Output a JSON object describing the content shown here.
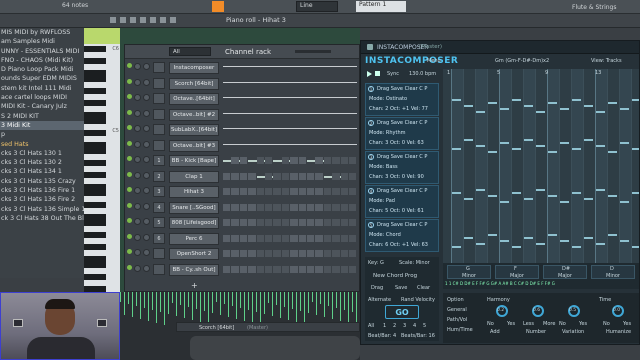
{
  "topbar": {
    "notes_label": "64 notes",
    "line_label": "Line",
    "pattern_label": "Pattern 1",
    "instrument": "Flute & Strings"
  },
  "pianoroll": {
    "title": "Piano roll - Hihat 3"
  },
  "browser": {
    "items": [
      {
        "label": "MIS MIDI by RWFLOSS",
        "state": "normal"
      },
      {
        "label": "am Samples Midi",
        "state": "normal"
      },
      {
        "label": "UNNY - ESSENTIALS MIDI",
        "state": "normal"
      },
      {
        "label": "FNO - CHAOS (Midi Kit)",
        "state": "normal"
      },
      {
        "label": "D Piano Loop Pack Midi",
        "state": "normal"
      },
      {
        "label": "ounds Super EDM MIDIS",
        "state": "normal"
      },
      {
        "label": "stem kit Intel 111 Midi",
        "state": "normal"
      },
      {
        "label": "ace cartel loops MIDI",
        "state": "normal"
      },
      {
        "label": "MIDI Kit - Canary Julz",
        "state": "normal"
      },
      {
        "label": "S 2 MIDI KIT",
        "state": "normal"
      },
      {
        "label": "3 Midi Kit",
        "state": "highlight"
      },
      {
        "label": "p",
        "state": "normal"
      },
      {
        "label": "sed Hats",
        "state": "folder"
      },
      {
        "label": "cks 3 Cl Hats 130 1",
        "state": "normal"
      },
      {
        "label": "cks 3 Cl Hats 130 2",
        "state": "normal"
      },
      {
        "label": "cks 3 Cl Hats 134 1",
        "state": "normal"
      },
      {
        "label": "cks 3 Cl Hats 135 Crazy",
        "state": "normal"
      },
      {
        "label": "cks 3 Cl Hats 136 Fire 1",
        "state": "normal"
      },
      {
        "label": "cks 3 Cl Hats 136 Fire 2",
        "state": "normal"
      },
      {
        "label": "cks 3 Cl Hats 136 Simple 1",
        "state": "normal"
      },
      {
        "label": "ck 3 Cl Hats 38 Out The Blue",
        "state": "normal"
      }
    ]
  },
  "piano_keys": {
    "c6": "C6",
    "c5": "C5"
  },
  "rack": {
    "filter": "All",
    "title": "Channel rack",
    "channels": [
      {
        "num": "",
        "name": "Instacomposer"
      },
      {
        "num": "",
        "name": "Scorch [64bit]"
      },
      {
        "num": "",
        "name": "Octave..[64bit]"
      },
      {
        "num": "",
        "name": "Octave..bit] #2"
      },
      {
        "num": "",
        "name": "SubLabX..[64bit]"
      },
      {
        "num": "",
        "name": "Octave..bit] #3"
      },
      {
        "num": "1",
        "name": "BB - Kick [Bape]"
      },
      {
        "num": "2",
        "name": "Clap 1"
      },
      {
        "num": "3",
        "name": "Hihat 3"
      },
      {
        "num": "4",
        "name": "Snare [..SGood]"
      },
      {
        "num": "5",
        "name": "808 [Lifeisgood]"
      },
      {
        "num": "6",
        "name": "Perc 6"
      },
      {
        "num": "",
        "name": "OpenShort 2"
      },
      {
        "num": "",
        "name": "BB - Cy..sh Out]"
      }
    ],
    "add_label": "+"
  },
  "bottom_track": {
    "label": "Scorch [64bit]",
    "sublabel": "(Master)"
  },
  "insta": {
    "title": "INSTACOMPOSER",
    "subtitle": "(Master)",
    "menu": "Menu",
    "bpm_label": "Sync",
    "bpm": "130.0 bpm",
    "progression": "Gm (Gm-F-D#-Dm)x2",
    "view": "View: Tracks",
    "pos": "Pos: Beats",
    "bars": [
      "1",
      "5",
      "9",
      "13"
    ],
    "cards": [
      {
        "n": "1",
        "actions": "Drag Save Clear C P",
        "mode": "Mode: Ostinato",
        "chan": "Chan: 2   Oct: +1   Vel: 77"
      },
      {
        "n": "2",
        "actions": "Drag Save Clear C P",
        "mode": "Mode: Rhythm",
        "chan": "Chan: 3   Oct: 0   Vel: 63"
      },
      {
        "n": "3",
        "actions": "Drag Save Clear C P",
        "mode": "Mode: Bass",
        "chan": "Chan: 3   Oct: 0   Vel: 90"
      },
      {
        "n": "4",
        "actions": "Drag Save Clear C P",
        "mode": "Mode: Pad",
        "chan": "Chan: 5   Oct: 0   Vel: 61"
      },
      {
        "n": "5",
        "actions": "Drag Save Clear C P",
        "mode": "Mode: Chord",
        "chan": "Chan: 6   Oct: +1   Vel: 63"
      }
    ],
    "key": "Key: G",
    "scale": "Scale: Minor",
    "new_chord": "New Chord Prog",
    "drag": "Drag",
    "save": "Save",
    "clear": "Clear",
    "alternate": "Alternate",
    "rand_velocity": "Rand Velocity",
    "go": "GO",
    "all": "All",
    "nums": [
      "1",
      "2",
      "3",
      "4",
      "5"
    ],
    "beat_bar": "Beat/Bar: 4",
    "beats_bar": "Beats/Bar: 16",
    "chords": [
      {
        "name": "G",
        "q": "Minor"
      },
      {
        "name": "F",
        "q": "Major"
      },
      {
        "name": "D#",
        "q": "Major"
      },
      {
        "name": "D",
        "q": "Minor"
      }
    ],
    "chord_notes": "1 1 C# D D# E F F# G G# A A# B C C# D D# E F F# G",
    "option": "Option",
    "general": "General",
    "path_vol": "Path/Vol",
    "humtime": "Hum/Time",
    "harmony": "Harmony",
    "time": "Time",
    "knobs": [
      {
        "v": "0.2",
        "top": "No",
        "bot": "Add"
      },
      {
        "v": "0.6",
        "top": "Less",
        "bot": "Number"
      },
      {
        "v": "0.5",
        "top": "No",
        "bot": "Variation"
      },
      {
        "v": "0.0",
        "top": "No",
        "bot": "Humanize"
      }
    ],
    "yes_labels": [
      "Yes",
      "More",
      "Yes",
      "Yes"
    ]
  }
}
